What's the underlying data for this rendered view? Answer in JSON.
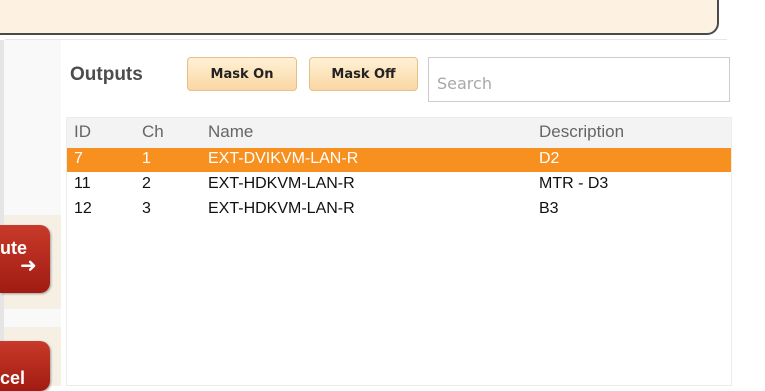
{
  "side_buttons": {
    "route": {
      "label": "ute",
      "arrow_icon": "right-arrow-icon"
    },
    "cancel": {
      "label": "cel"
    }
  },
  "outputs": {
    "title": "Outputs",
    "mask_on_label": "Mask On",
    "mask_off_label": "Mask Off",
    "search_placeholder": "Search"
  },
  "table": {
    "columns": [
      "ID",
      "Ch",
      "Name",
      "Description"
    ],
    "rows": [
      {
        "id": "7",
        "ch": "1",
        "name": "EXT-DVIKVM-LAN-R",
        "description": "D2",
        "selected": true
      },
      {
        "id": "11",
        "ch": "2",
        "name": "EXT-HDKVM-LAN-R",
        "description": "MTR - D3",
        "selected": false
      },
      {
        "id": "12",
        "ch": "3",
        "name": "EXT-HDKVM-LAN-R",
        "description": "B3",
        "selected": false
      }
    ]
  },
  "colors": {
    "selected_row": "#f7901e",
    "button_bg": "#fbe0b2",
    "side_button": "#b3261a",
    "top_panel": "#fdf1e1"
  }
}
